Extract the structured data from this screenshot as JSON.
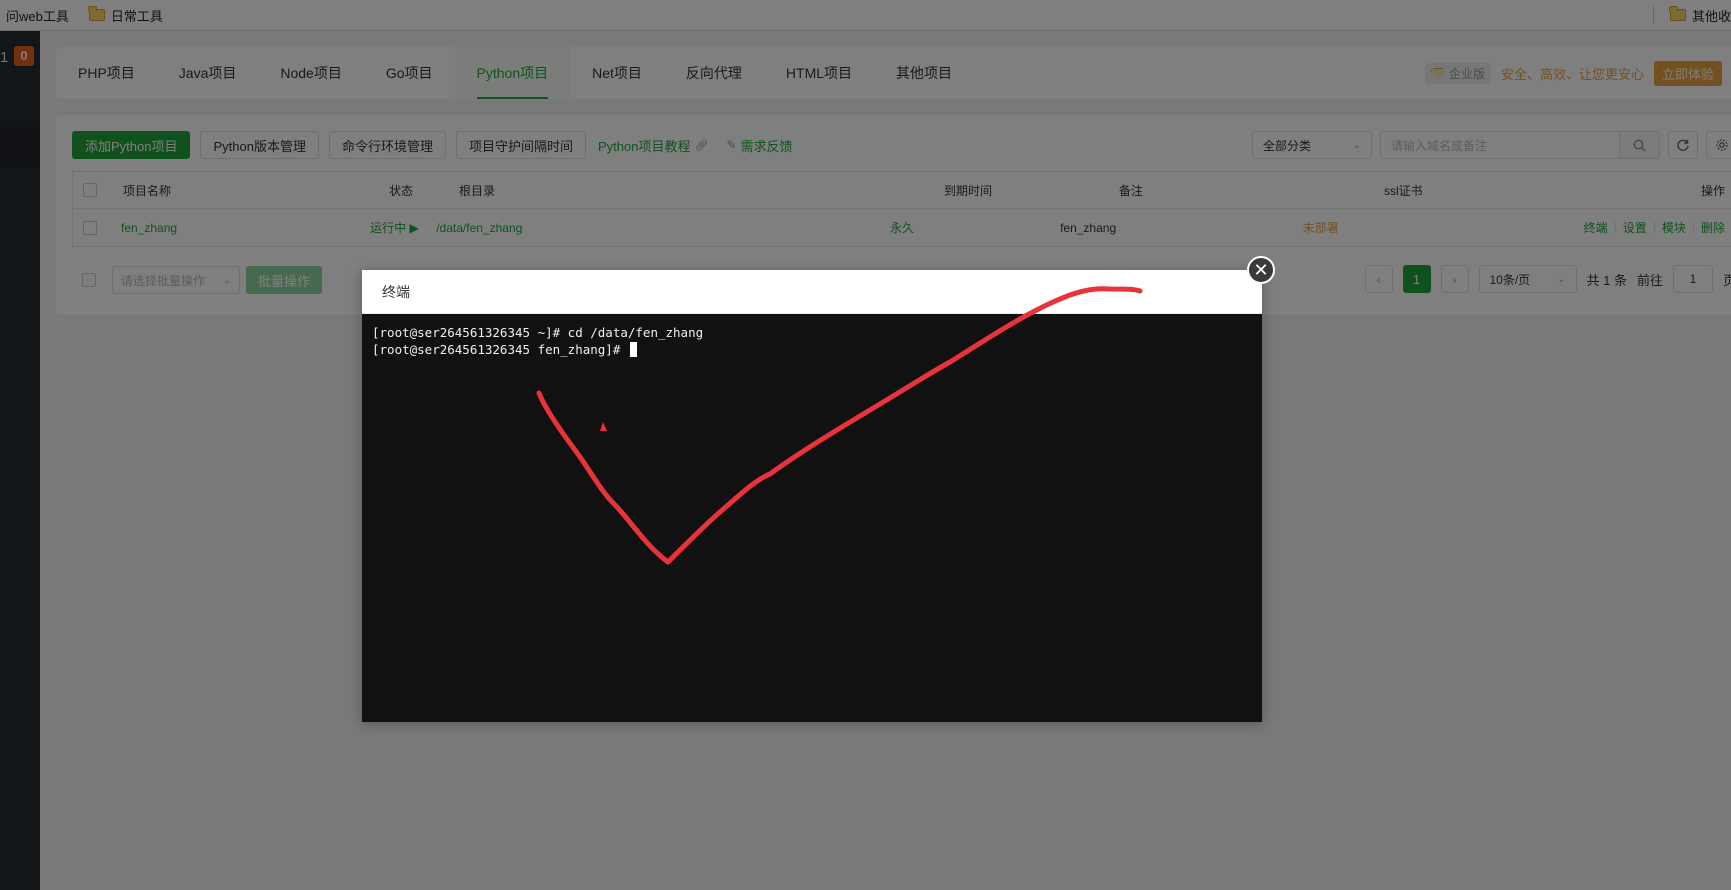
{
  "bookmarks": {
    "items": [
      {
        "label": "问web工具",
        "icon": "none"
      },
      {
        "label": "日常工具",
        "icon": "folder-icon"
      }
    ],
    "other": "其他收"
  },
  "sidebar": {
    "number": "1",
    "badge": "0"
  },
  "tabs": [
    {
      "label": "PHP项目"
    },
    {
      "label": "Java项目"
    },
    {
      "label": "Node项目"
    },
    {
      "label": "Go项目"
    },
    {
      "label": "Python项目",
      "active": true
    },
    {
      "label": "Net项目"
    },
    {
      "label": "反向代理"
    },
    {
      "label": "HTML项目"
    },
    {
      "label": "其他项目"
    }
  ],
  "promo": {
    "badge": "企业版",
    "text": "安全、高效、让您更安心",
    "button": "立即体验"
  },
  "toolbar": {
    "add": "添加Python项目",
    "version": "Python版本管理",
    "cmd_env": "命令行环境管理",
    "guard_interval": "项目守护间隔时间",
    "tutorial": "Python项目教程",
    "feedback": "需求反馈",
    "category": "全部分类",
    "search_placeholder": "请输入域名或备注"
  },
  "table": {
    "headers": {
      "name": "项目名称",
      "status": "状态",
      "root": "根目录",
      "expire": "到期时间",
      "note": "备注",
      "ssl": "ssl证书",
      "ops": "操作"
    },
    "rows": [
      {
        "name": "fen_zhang",
        "status": "运行中 ▶",
        "root": "/data/fen_zhang",
        "expire": "永久",
        "note": "fen_zhang",
        "ssl": "未部署",
        "ops": [
          "终端",
          "设置",
          "模块",
          "删除"
        ]
      }
    ]
  },
  "footer": {
    "batch_placeholder": "请选择批量操作",
    "batch_button": "批量操作",
    "current_page": "1",
    "per_page": "10条/页",
    "total": "共 1 条",
    "goto_prefix": "前往",
    "goto_value": "1",
    "goto_suffix": "页"
  },
  "modal": {
    "title": "终端",
    "lines": [
      "[root@ser264561326345 ~]# cd /data/fen_zhang",
      "[root@ser264561326345 fen_zhang]# "
    ]
  },
  "colors": {
    "accent": "#20a53a",
    "warning": "#e6a23c",
    "annotation": "#e8333a"
  }
}
